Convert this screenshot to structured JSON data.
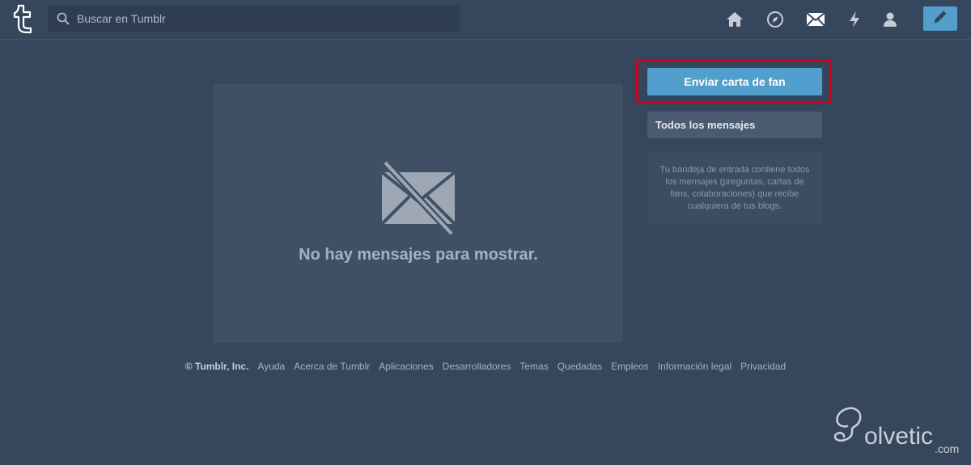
{
  "header": {
    "logo_letter": "t",
    "search": {
      "placeholder": "Buscar en Tumblr",
      "value": ""
    },
    "nav_icons": [
      "home-icon",
      "compass-icon",
      "mail-icon",
      "lightning-icon",
      "user-icon"
    ],
    "compose_icon": "pencil-icon"
  },
  "main": {
    "empty_icon": "no-mail-icon",
    "empty_text": "No hay mensajes para mostrar."
  },
  "sidebar": {
    "fan_mail_button": "Enviar carta de fan",
    "all_messages_label": "Todos los mensajes",
    "info_text": "Tu bandeja de entrada contiene todos los mensajes (preguntas, cartas de fans, colaboraciones) que recibe cualquiera de tus blogs."
  },
  "footer": {
    "copyright": "© Tumblr, Inc.",
    "links": [
      "Ayuda",
      "Acerca de Tumblr",
      "Aplicaciones",
      "Desarrolladores",
      "Temas",
      "Quedadas",
      "Empleos",
      "Información legal",
      "Privacidad"
    ]
  },
  "watermark": {
    "text": "olvetic",
    "suffix": ".com"
  },
  "colors": {
    "background": "#36465d",
    "accent": "#529ecc",
    "highlight_border": "#d0021b"
  }
}
